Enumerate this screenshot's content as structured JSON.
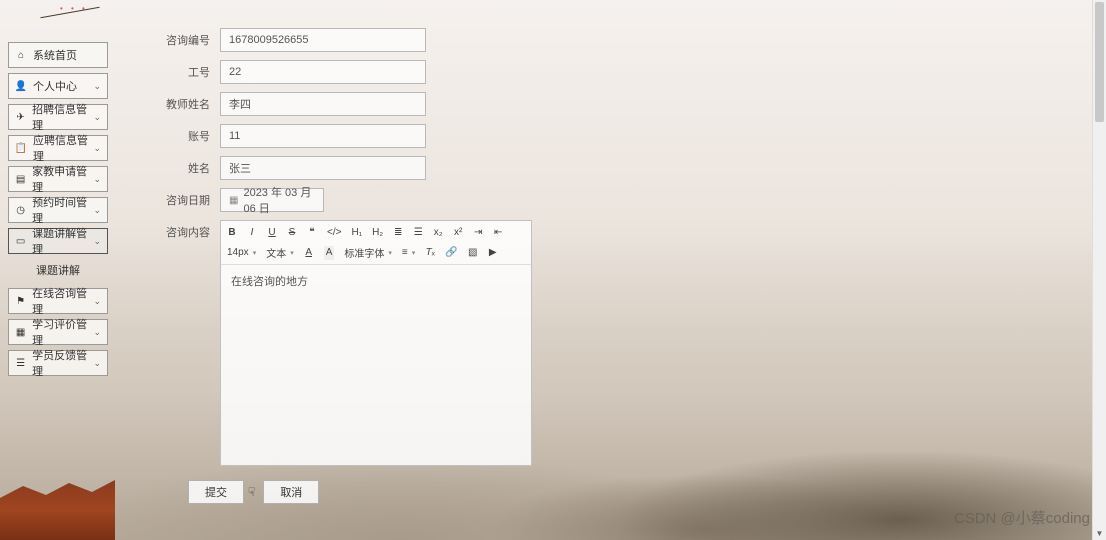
{
  "sidebar": {
    "items": [
      {
        "icon": "home",
        "label": "系统首页",
        "expandable": false
      },
      {
        "icon": "user",
        "label": "个人中心",
        "expandable": true
      },
      {
        "icon": "send",
        "label": "招聘信息管理",
        "expandable": true
      },
      {
        "icon": "clipboard",
        "label": "应聘信息管理",
        "expandable": true
      },
      {
        "icon": "book",
        "label": "家教申请管理",
        "expandable": true
      },
      {
        "icon": "clock",
        "label": "预约时间管理",
        "expandable": true
      },
      {
        "icon": "chat",
        "label": "课题讲解管理",
        "expandable": true,
        "active": true
      },
      {
        "icon": "flag",
        "label": "在线咨询管理",
        "expandable": true
      },
      {
        "icon": "grid",
        "label": "学习评价管理",
        "expandable": true
      },
      {
        "icon": "feedback",
        "label": "学员反馈管理",
        "expandable": true
      }
    ],
    "submenu_label": "课题讲解"
  },
  "form": {
    "consult_no": {
      "label": "咨询编号",
      "value": "1678009526655"
    },
    "job_no": {
      "label": "工号",
      "value": "22"
    },
    "teacher_name": {
      "label": "教师姓名",
      "value": "李四"
    },
    "account": {
      "label": "账号",
      "value": "11"
    },
    "name": {
      "label": "姓名",
      "value": "张三"
    },
    "consult_date": {
      "label": "咨询日期",
      "value": "2023 年 03 月 06 日"
    },
    "consult_content_label": "咨询内容"
  },
  "editor": {
    "fontsize": "14px",
    "paragraph": "文本",
    "fontfamily": "标准字体",
    "content": "在线咨询的地方"
  },
  "actions": {
    "submit": "提交",
    "cancel": "取消"
  },
  "watermark": "CSDN @小蔡coding",
  "icons": {
    "home": "⌂",
    "user": "👤",
    "send": "✈",
    "clipboard": "📋",
    "book": "▤",
    "clock": "◷",
    "chat": "▭",
    "flag": "⚑",
    "grid": "▦",
    "feedback": "☰"
  }
}
